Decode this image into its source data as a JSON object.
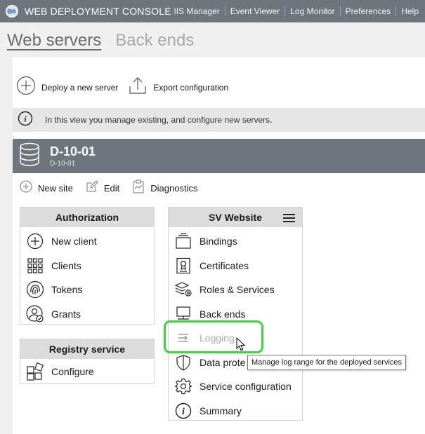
{
  "app": {
    "title": "WEB DEPLOYMENT CONSOLE"
  },
  "topnav": {
    "items": [
      "IIS Manager",
      "Event Viewer",
      "Log Monitor",
      "Preferences",
      "Help"
    ]
  },
  "page_tabs": {
    "items": [
      {
        "label": "Web servers",
        "active": true
      },
      {
        "label": "Back ends",
        "active": false
      }
    ]
  },
  "actions": {
    "deploy_label": "Deploy a new server",
    "export_label": "Export configuration"
  },
  "info": {
    "text": "In this view you manage existing, and configure new servers."
  },
  "server": {
    "name": "D-10-01",
    "subtitle": "D-10-01"
  },
  "site_actions": {
    "new_site": "New site",
    "edit": "Edit",
    "diagnostics": "Diagnostics"
  },
  "authorization": {
    "title": "Authorization",
    "items": [
      "New client",
      "Clients",
      "Tokens",
      "Grants"
    ]
  },
  "registry": {
    "title": "Registry service",
    "items": [
      "Configure"
    ]
  },
  "website": {
    "title": "SV Website",
    "items": [
      "Bindings",
      "Certificates",
      "Roles & Services",
      "Back ends",
      "Logging",
      "Data prote",
      "Service configuration",
      "Summary"
    ]
  },
  "tooltip": {
    "text": "Manage log range for the deployed services"
  },
  "colors": {
    "topbar": "#6e757d",
    "server_bar": "#6e757d",
    "highlight": "#3dd63d"
  },
  "icons": {
    "logo": "globe-icon",
    "deploy": "plus-circle-icon",
    "export": "upload-icon",
    "info": "info-icon",
    "server": "database-icon",
    "menu": "hamburger-icon"
  }
}
